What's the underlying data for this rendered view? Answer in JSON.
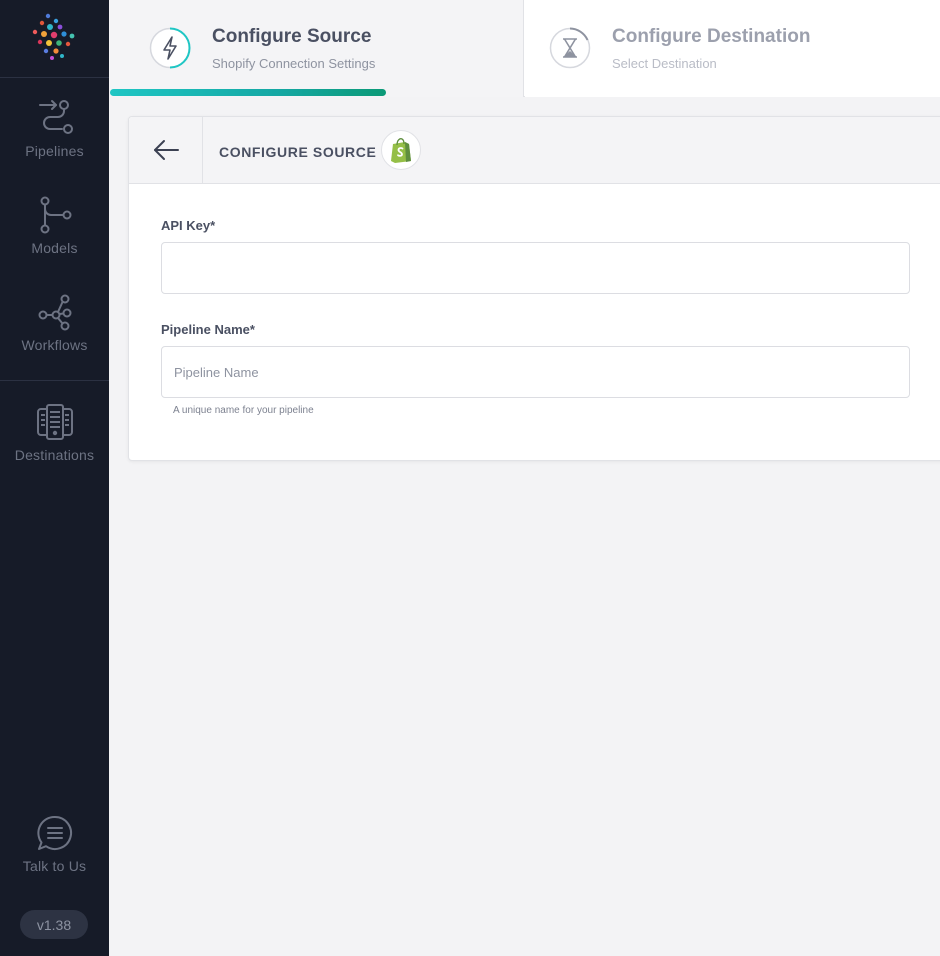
{
  "sidebar": {
    "items": [
      {
        "label": "Pipelines",
        "icon": "pipelines-icon"
      },
      {
        "label": "Models",
        "icon": "models-icon"
      },
      {
        "label": "Workflows",
        "icon": "workflows-icon"
      },
      {
        "label": "Destinations",
        "icon": "destinations-icon"
      }
    ],
    "help": {
      "label": "Talk to Us",
      "icon": "chat-icon"
    },
    "version": "v1.38"
  },
  "stepper": {
    "steps": [
      {
        "title": "Configure Source",
        "subtitle": "Shopify Connection Settings",
        "icon": "lightning-icon",
        "active": true
      },
      {
        "title": "Configure Destination",
        "subtitle": "Select Destination",
        "icon": "hourglass-icon",
        "active": false
      }
    ]
  },
  "card": {
    "title": "CONFIGURE SOURCE",
    "source_icon": "shopify-icon",
    "fields": {
      "api_key": {
        "label": "API Key*",
        "value": "",
        "placeholder": ""
      },
      "pipeline_name": {
        "label": "Pipeline Name*",
        "value": "",
        "placeholder": "Pipeline Name",
        "hint": "A unique name for your pipeline"
      }
    }
  },
  "colors": {
    "sidebar_bg": "#161b28",
    "accent": "#1fc6c4",
    "accent_end": "#0b9a77",
    "shopify_green": "#95bf47"
  }
}
